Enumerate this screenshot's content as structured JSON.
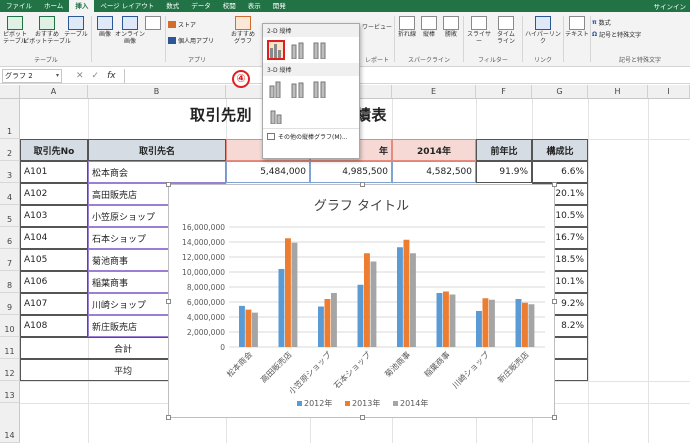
{
  "ribbon": {
    "tabs": [
      "ファイル",
      "ホーム",
      "挿入",
      "ページ レイアウト",
      "数式",
      "データ",
      "校閲",
      "表示",
      "開発"
    ],
    "active_tab": "挿入",
    "signin": "サインイン",
    "buttons": {
      "pivot": "ピボット\nテーブル",
      "recommended_pivot": "おすすめ\nピボットテーブル",
      "table": "テーブル",
      "picture": "画像",
      "online_picture": "オンライン\n画像",
      "store": "ストア",
      "personal_apps": "個人用アプリ",
      "recommended_chart": "おすすめ\nグラフ",
      "power_view": "ワービュー",
      "line": "折れ線",
      "column": "縦棒",
      "winloss": "勝敗",
      "slicer": "スライサー",
      "timeline": "タイム\nライン",
      "hyperlink": "ハイパーリンク",
      "text": "テキスト",
      "equation": "数式",
      "symbol": "記号と特殊文字"
    },
    "groups": {
      "tables": "テーブル",
      "apps": "アプリ",
      "reports": "レポート",
      "sparklines": "スパークライン",
      "filters": "フィルター",
      "links": "リンク",
      "symbols": "記号と特殊文字"
    }
  },
  "gallery": {
    "section_2d": "2-D 縦棒",
    "section_3d": "3-D 縦棒",
    "more_link": "その他の縦棒グラフ(M)...",
    "step_badge": "④"
  },
  "formula_bar": {
    "name_box": "グラフ 2",
    "cancel": "✕",
    "enter": "✓",
    "fx": "fx"
  },
  "columns": [
    "A",
    "B",
    "C",
    "D",
    "E",
    "F",
    "G",
    "H",
    "I"
  ],
  "rows": [
    "1",
    "2",
    "3",
    "4",
    "5",
    "6",
    "7",
    "8",
    "9",
    "10",
    "11",
    "12",
    "13",
    "14"
  ],
  "sheet": {
    "title_left": "取引先別",
    "title_right": ":実績表",
    "headers": {
      "id": "取引先No",
      "name": "取引先名",
      "y2012": "20",
      "y2013": "年",
      "y2014": "2014年",
      "yoy": "前年比",
      "share": "構成比"
    },
    "rows": [
      {
        "id": "A101",
        "name": "松本商会",
        "v2012": "5,484,000",
        "v2013": "4,985,500",
        "v2014": "4,582,500",
        "yoy": "91.9%",
        "share": "6.6%"
      },
      {
        "id": "A102",
        "name": "高田販売店",
        "share": "20.1%"
      },
      {
        "id": "A103",
        "name": "小笠原ショップ",
        "share": "10.5%"
      },
      {
        "id": "A104",
        "name": "石本ショップ",
        "share": "16.7%"
      },
      {
        "id": "A105",
        "name": "菊池商事",
        "share": "18.5%"
      },
      {
        "id": "A106",
        "name": "稲葉商事",
        "share": "10.1%"
      },
      {
        "id": "A107",
        "name": "川崎ショップ",
        "share": "9.2%"
      },
      {
        "id": "A108",
        "name": "新庄販売店",
        "share": "8.2%"
      }
    ],
    "total_label": "合計",
    "avg_label": "平均"
  },
  "colors": {
    "excel_green": "#217346",
    "series_2012": "#5b9bd5",
    "series_2013": "#ed7d31",
    "series_2014": "#a5a5a5",
    "header_fill": "#d6dce4",
    "selection_red": "#e02020"
  },
  "chart_data": {
    "type": "bar",
    "title": "グラフ タイトル",
    "categories": [
      "松本商会",
      "高田販売店",
      "小笠原ショップ",
      "石本ショップ",
      "菊池商事",
      "稲葉商事",
      "川崎ショップ",
      "新庄販売店"
    ],
    "series": [
      {
        "name": "2012年",
        "values": [
          5484000,
          10400000,
          5400000,
          8300000,
          13300000,
          7200000,
          4800000,
          6400000
        ]
      },
      {
        "name": "2013年",
        "values": [
          4985500,
          14500000,
          6400000,
          12500000,
          14300000,
          7400000,
          6500000,
          5900000
        ]
      },
      {
        "name": "2014年",
        "values": [
          4582500,
          13900000,
          7200000,
          11400000,
          12500000,
          7000000,
          6300000,
          5700000
        ]
      }
    ],
    "ylim": [
      0,
      16000000
    ],
    "yticks": [
      "0",
      "2,000,000",
      "4,000,000",
      "6,000,000",
      "8,000,000",
      "10,000,000",
      "12,000,000",
      "14,000,000",
      "16,000,000"
    ],
    "grid": true,
    "legend": "bottom"
  }
}
